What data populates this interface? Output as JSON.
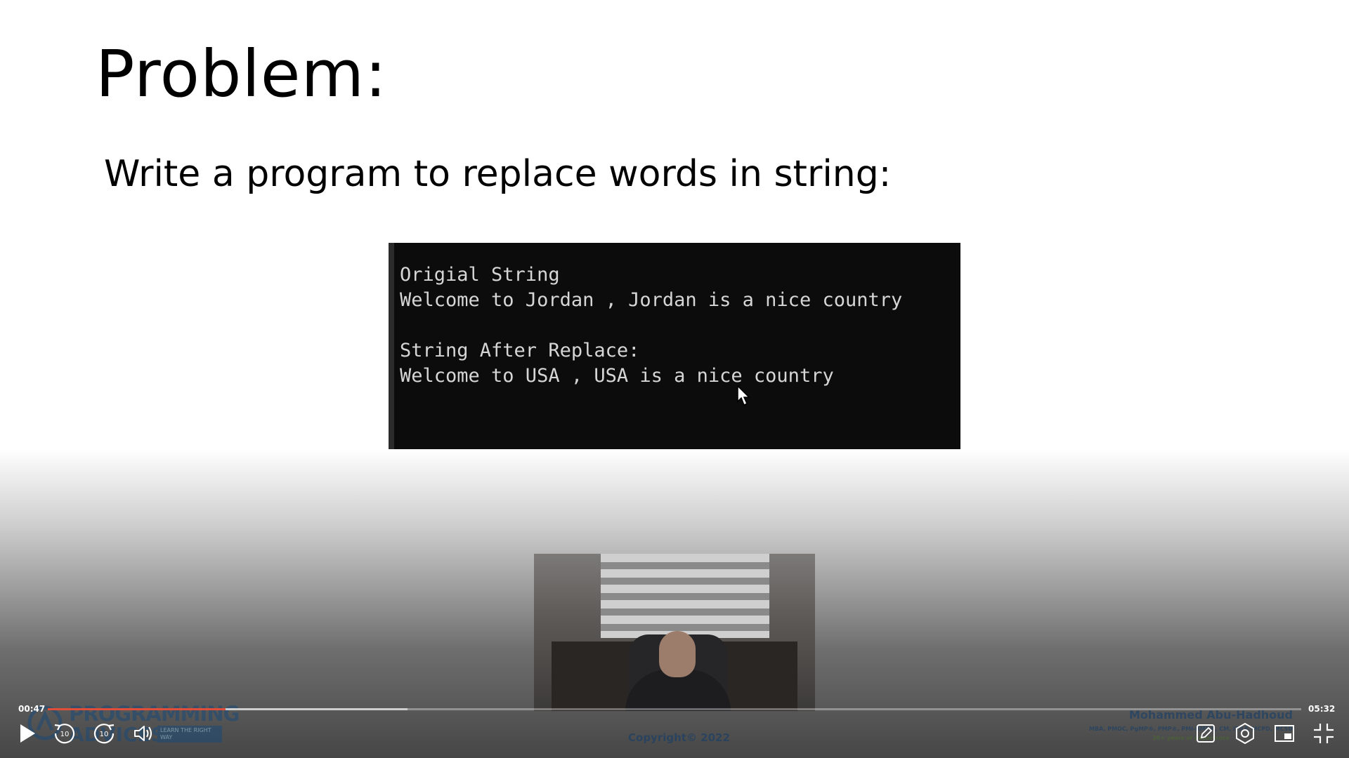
{
  "slide": {
    "title": "Problem:",
    "subtitle": "Write a program to replace words in string:",
    "console_lines": [
      "Origial String",
      "Welcome to Jordan , Jordan is a nice country",
      "",
      "String After Replace:",
      "Welcome to USA , USA is a nice country"
    ]
  },
  "branding": {
    "logo_line1": "PROGRAMMING",
    "logo_line2": "ADVICES",
    "logo_badge": "LEARN THE RIGHT WAY",
    "copyright": "Copyright© 2022",
    "author_name": "Mohammed Abu-Hadhoud",
    "author_credentials": "MBA, PMOC, PgMP®, PMP®, PMI-RMP®, CM, ITILF, MCPD, MCSD",
    "author_experience": "26+ years of experience"
  },
  "player": {
    "current_time": "00:47",
    "duration": "05:32",
    "played_fraction": 0.1416,
    "buffered_fraction": 0.287,
    "state": "paused",
    "icons": {
      "play": "play-icon",
      "rewind": "rewind-10-icon",
      "forward": "forward-10-icon",
      "volume": "volume-icon",
      "notes": "pencil-icon",
      "settings": "settings-icon",
      "pip": "picture-in-picture-icon",
      "exit_fullscreen": "exit-fullscreen-icon"
    },
    "skip_seconds": "10"
  },
  "colors": {
    "accent_progress": "#e04e39",
    "console_bg": "#0c0c0c",
    "console_text": "#d6d6d6",
    "brand_blue": "#1b4a78"
  }
}
